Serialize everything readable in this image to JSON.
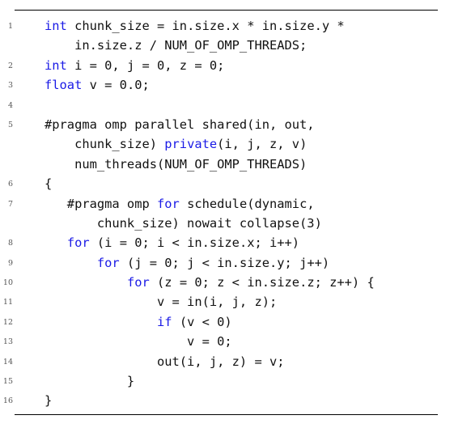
{
  "colors": {
    "keyword": "#1a1ae6",
    "text": "#111111",
    "line_number": "#555555",
    "rule": "#000000"
  },
  "listing": [
    {
      "num": "1",
      "segments": [
        [
          "kw",
          "int"
        ],
        [
          "t",
          " chunk_size = in.size.x * in.size.y *"
        ]
      ]
    },
    {
      "num": "",
      "segments": [
        [
          "t",
          "    in.size.z / NUM_OF_OMP_THREADS;"
        ]
      ]
    },
    {
      "num": "2",
      "segments": [
        [
          "kw",
          "int"
        ],
        [
          "t",
          " i = 0, j = 0, z = 0;"
        ]
      ]
    },
    {
      "num": "3",
      "segments": [
        [
          "kw",
          "float"
        ],
        [
          "t",
          " v = 0.0;"
        ]
      ]
    },
    {
      "num": "4",
      "segments": []
    },
    {
      "num": "5",
      "segments": [
        [
          "t",
          "#pragma omp parallel shared(in, out,"
        ]
      ]
    },
    {
      "num": "",
      "segments": [
        [
          "t",
          "    chunk_size) "
        ],
        [
          "kw",
          "private"
        ],
        [
          "t",
          "(i, j, z, v)"
        ]
      ]
    },
    {
      "num": "",
      "segments": [
        [
          "t",
          "    num_threads(NUM_OF_OMP_THREADS)"
        ]
      ]
    },
    {
      "num": "6",
      "segments": [
        [
          "t",
          "{"
        ]
      ]
    },
    {
      "num": "7",
      "segments": [
        [
          "t",
          "   #pragma omp "
        ],
        [
          "kw",
          "for"
        ],
        [
          "t",
          " schedule(dynamic,"
        ]
      ]
    },
    {
      "num": "",
      "segments": [
        [
          "t",
          "       chunk_size) nowait collapse(3)"
        ]
      ]
    },
    {
      "num": "8",
      "segments": [
        [
          "t",
          "   "
        ],
        [
          "kw",
          "for"
        ],
        [
          "t",
          " (i = 0; i < in.size.x; i++)"
        ]
      ]
    },
    {
      "num": "9",
      "segments": [
        [
          "t",
          "       "
        ],
        [
          "kw",
          "for"
        ],
        [
          "t",
          " (j = 0; j < in.size.y; j++)"
        ]
      ]
    },
    {
      "num": "10",
      "segments": [
        [
          "t",
          "           "
        ],
        [
          "kw",
          "for"
        ],
        [
          "t",
          " (z = 0; z < in.size.z; z++) {"
        ]
      ]
    },
    {
      "num": "11",
      "segments": [
        [
          "t",
          "               v = in(i, j, z);"
        ]
      ]
    },
    {
      "num": "12",
      "segments": [
        [
          "t",
          "               "
        ],
        [
          "kw",
          "if"
        ],
        [
          "t",
          " (v < 0)"
        ]
      ]
    },
    {
      "num": "13",
      "segments": [
        [
          "t",
          "                   v = 0;"
        ]
      ]
    },
    {
      "num": "14",
      "segments": [
        [
          "t",
          "               out(i, j, z) = v;"
        ]
      ]
    },
    {
      "num": "15",
      "segments": [
        [
          "t",
          "           }"
        ]
      ]
    },
    {
      "num": "16",
      "segments": [
        [
          "t",
          "}"
        ]
      ]
    }
  ]
}
